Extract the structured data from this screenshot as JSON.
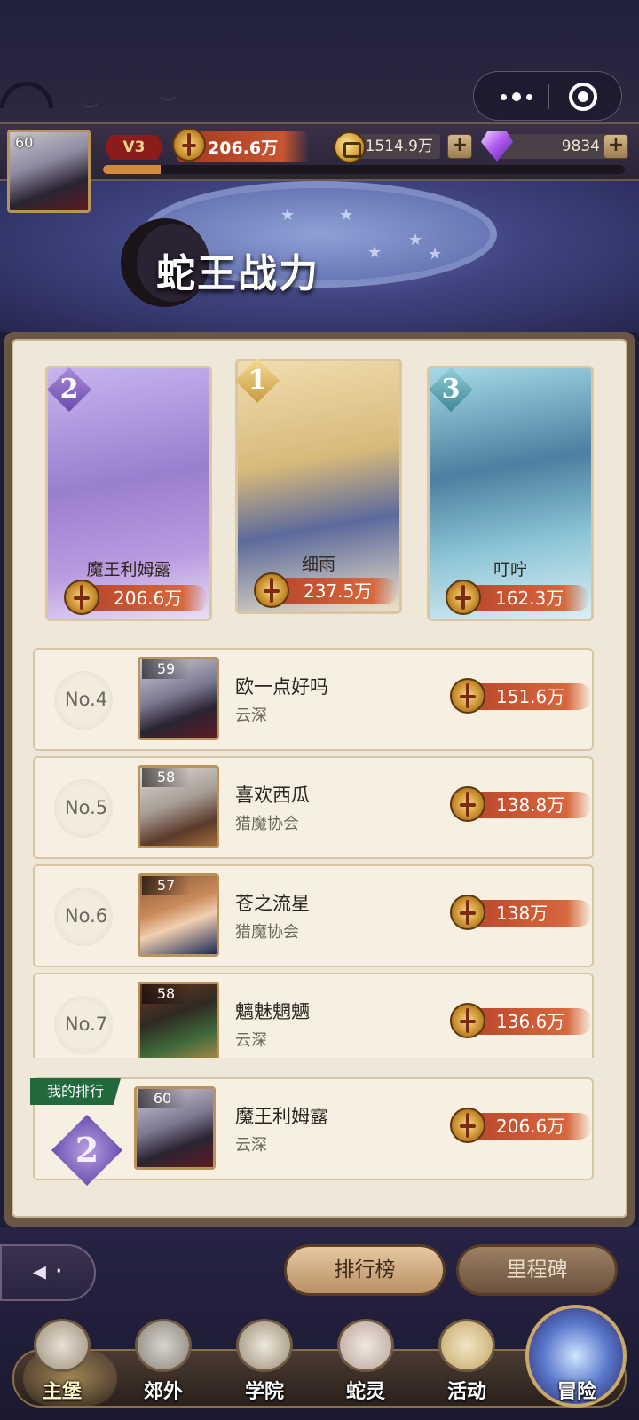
{
  "capsule": {
    "more_icon": "more-dots-icon",
    "close_icon": "target-close-icon"
  },
  "player": {
    "level": "60",
    "vip": "V3",
    "power": "206.6万",
    "gold": "1514.9万",
    "gems": "9834",
    "exp_fraction": 0.11
  },
  "banner": {
    "title": "蛇王战力"
  },
  "podium": [
    {
      "rank": "2",
      "name": "魔王利姆露",
      "power": "206.6万",
      "color": "#b89ae0"
    },
    {
      "rank": "1",
      "name": "细雨",
      "power": "237.5万",
      "color": "#e8cf93"
    },
    {
      "rank": "3",
      "name": "叮咛",
      "power": "162.3万",
      "color": "#8fc6d8"
    }
  ],
  "list": [
    {
      "no": "No.4",
      "level": "59",
      "name": "欧一点好吗",
      "guild": "云深",
      "power": "151.6万"
    },
    {
      "no": "No.5",
      "level": "58",
      "name": "喜欢西瓜",
      "guild": "猎魔协会",
      "power": "138.8万"
    },
    {
      "no": "No.6",
      "level": "57",
      "name": "苍之流星",
      "guild": "猎魔协会",
      "power": "138万"
    },
    {
      "no": "No.7",
      "level": "58",
      "name": "魑魅魍魉",
      "guild": "云深",
      "power": "136.6万"
    }
  ],
  "my_rank": {
    "tag": "我的排行",
    "rank": "2",
    "level": "60",
    "name": "魔王利姆露",
    "guild": "云深",
    "power": "206.6万"
  },
  "buttons": {
    "leaderboard": "排行榜",
    "milestone": "里程碑",
    "back_icon": "back-arrow-icon"
  },
  "nav": [
    {
      "label": "主堡",
      "icon": "castle-icon",
      "active": true
    },
    {
      "label": "郊外",
      "icon": "crossed-swords-icon"
    },
    {
      "label": "学院",
      "icon": "academy-icon"
    },
    {
      "label": "蛇灵",
      "icon": "snake-spirit-icon"
    },
    {
      "label": "活动",
      "icon": "gift-box-icon"
    },
    {
      "label": "冒险",
      "icon": "adventure-portal-icon"
    }
  ]
}
